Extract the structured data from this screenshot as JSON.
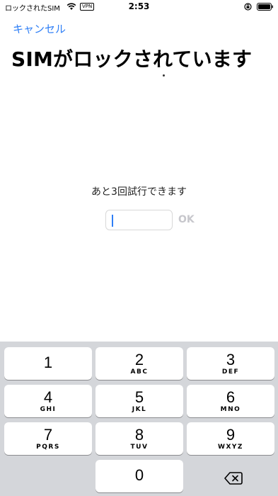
{
  "status_bar": {
    "carrier": "ロックされたSIM",
    "vpn": "VPN",
    "time": "2:53"
  },
  "header": {
    "cancel_label": "キャンセル",
    "title": "SIMがロックされています"
  },
  "pin": {
    "attempts_text": "あと3回試行できます",
    "value": "",
    "ok_label": "OK"
  },
  "keypad": {
    "keys": [
      {
        "num": "1",
        "letters": ""
      },
      {
        "num": "2",
        "letters": "ABC"
      },
      {
        "num": "3",
        "letters": "DEF"
      },
      {
        "num": "4",
        "letters": "GHI"
      },
      {
        "num": "5",
        "letters": "JKL"
      },
      {
        "num": "6",
        "letters": "MNO"
      },
      {
        "num": "7",
        "letters": "PQRS"
      },
      {
        "num": "8",
        "letters": "TUV"
      },
      {
        "num": "9",
        "letters": "WXYZ"
      },
      {
        "num": "0",
        "letters": ""
      }
    ],
    "delete_icon": "backspace-icon"
  },
  "colors": {
    "accent": "#2f7ff6",
    "keypad_bg": "#d4d6da",
    "ok_disabled": "#c7c7cc"
  }
}
